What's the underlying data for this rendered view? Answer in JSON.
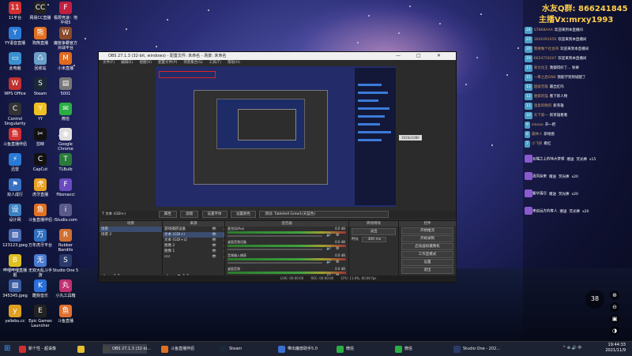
{
  "desktop": {
    "icons": [
      {
        "label": "11平台",
        "color": "#d03030",
        "glyph": "11"
      },
      {
        "label": "网易CC直播",
        "color": "#222",
        "glyph": "CC"
      },
      {
        "label": "极限竞速：地平线5",
        "color": "#c02040",
        "glyph": "F"
      },
      {
        "label": "YY语音直播",
        "color": "#2b7bd6",
        "glyph": "Y"
      },
      {
        "label": "狗熊直播",
        "color": "#e07020",
        "glyph": "熊"
      },
      {
        "label": "魔兽争霸官方对战平台",
        "color": "#8a4a2a",
        "glyph": "W"
      },
      {
        "label": "此电脑",
        "color": "#3a90d0",
        "glyph": "▭"
      },
      {
        "label": "回收站",
        "color": "#6aa0c8",
        "glyph": "♺"
      },
      {
        "label": "小米直播",
        "color": "#e06a20",
        "glyph": "M"
      },
      {
        "label": "WPS Office",
        "color": "#c03030",
        "glyph": "W"
      },
      {
        "label": "Steam",
        "color": "#1b2838",
        "glyph": "S"
      },
      {
        "label": "5001",
        "color": "#777",
        "glyph": "▤"
      },
      {
        "label": "Control Singularity",
        "color": "#333",
        "glyph": "C"
      },
      {
        "label": "YY",
        "color": "#f0c020",
        "glyph": "Y"
      },
      {
        "label": "微信",
        "color": "#2aae44",
        "glyph": "✉"
      },
      {
        "label": "斗鱼直播伴侣",
        "color": "#d03030",
        "glyph": "鱼"
      },
      {
        "label": "剪映",
        "color": "#111",
        "glyph": "✂"
      },
      {
        "label": "Google Chrome",
        "color": "#dfdfdf",
        "glyph": "◉"
      },
      {
        "label": "迅雷",
        "color": "#2a7ad8",
        "glyph": "⚡"
      },
      {
        "label": "CapCut",
        "color": "#111",
        "glyph": "C"
      },
      {
        "label": "TLBulb",
        "color": "#2a7a3a",
        "glyph": "T"
      },
      {
        "label": "双人成行",
        "color": "#3a70c0",
        "glyph": "⚑"
      },
      {
        "label": "虎牙直播",
        "color": "#e8a020",
        "glyph": "虎"
      },
      {
        "label": "Fibonacci",
        "color": "#6a4ac0",
        "glyph": "F"
      },
      {
        "label": "设计网",
        "color": "#3a80c0",
        "glyph": "设"
      },
      {
        "label": "斗鱼直播伴侣",
        "color": "#e07020",
        "glyph": "鱼"
      },
      {
        "label": "iStudio.com",
        "color": "#5a5a8a",
        "glyph": "i"
      },
      {
        "label": "123123.jpeg",
        "color": "#4a6ab0",
        "glyph": "▧"
      },
      {
        "label": "万年虎牙平台",
        "color": "#3070c0",
        "glyph": "万"
      },
      {
        "label": "Rubber Bandits",
        "color": "#d07030",
        "glyph": "R"
      },
      {
        "label": "哔哩哔哩直播姬",
        "color": "#e0c020",
        "glyph": "B"
      },
      {
        "label": "无双大乱斗手游",
        "color": "#4a7ad0",
        "glyph": "无"
      },
      {
        "label": "Studio One 5",
        "color": "#2a3a6a",
        "glyph": "S"
      },
      {
        "label": "345345.jpeg",
        "color": "#3a5aa0",
        "glyph": "▧"
      },
      {
        "label": "酷狗音乐",
        "color": "#2a70d8",
        "glyph": "K"
      },
      {
        "label": "小丸工具箱",
        "color": "#c03070",
        "glyph": "丸"
      },
      {
        "label": "yaliebu.cc",
        "color": "#e0a020",
        "glyph": "y"
      },
      {
        "label": "Epic Games Launcher",
        "color": "#222",
        "glyph": "E"
      },
      {
        "label": "斗鱼直播",
        "color": "#e07030",
        "glyph": "鱼"
      }
    ]
  },
  "live_panel": {
    "qq_group": "水友Q群: 866241845",
    "host": "主播Vx:mrxy1993",
    "chat": [
      {
        "level": "24",
        "name": "GT868AAA",
        "text": "欢迎来到本直播间"
      },
      {
        "level": "23",
        "name": "1641091656",
        "text": "欢迎来到本直播间"
      },
      {
        "level": "20",
        "name": "我要做个社会哥",
        "text": "欢迎来到本直播间"
      },
      {
        "level": "19",
        "name": "6654759207",
        "text": "欢迎来到本直播间"
      },
      {
        "level": "17",
        "name": "宋文化王",
        "text": "我都得好了... 秋裤"
      },
      {
        "level": "15",
        "name": "一拳之后GNK",
        "text": "我能学到到城配了"
      },
      {
        "level": "13",
        "name": "超级无敌",
        "text": "最出红吗"
      },
      {
        "level": "12",
        "name": "谁家的猫",
        "text": "看下新人物"
      },
      {
        "level": "11",
        "name": "温柔的晚风",
        "text": "新英雄"
      },
      {
        "level": "10",
        "name": "天下第一",
        "text": "新英雄看看"
      },
      {
        "level": "9",
        "name": "xiaoao",
        "text": "开一把"
      },
      {
        "level": "8",
        "name": "森林人",
        "text": "新地图"
      },
      {
        "level": "7",
        "name": "小飞侠",
        "text": "看红"
      }
    ],
    "gifts": [
      {
        "name": "云端之上的伟大梦想",
        "action": "赠送",
        "item": "荧光棒",
        "count": "x15"
      },
      {
        "name": "清风徐来",
        "action": "赠送",
        "item": "荧光棒",
        "count": "x20"
      },
      {
        "name": "繁华落尽",
        "action": "赠送",
        "item": "荧光棒",
        "count": "x20"
      },
      {
        "name": "来自远方的客人",
        "action": "赠送",
        "item": "荧光棒",
        "count": "x20"
      }
    ],
    "viewer_badge": "38",
    "side_icons": [
      "⊕",
      "⊖",
      "▣",
      "◑"
    ]
  },
  "obs": {
    "title": "OBS 27.1.3 (32-bit, windows) - 配置文件: 未命名 - 场景: 未命名",
    "window_controls": [
      "—",
      "□",
      "✕"
    ],
    "menu": [
      "文件(F)",
      "编辑(E)",
      "视图(V)",
      "配置文件(P)",
      "场景集合(S)",
      "工具(T)",
      "帮助(H)"
    ],
    "preview_tag": "1920x1080",
    "source_bar": {
      "source_name": "文本 (GDI+)",
      "buttons": [
        "属性",
        "滤镜",
        "设置字体",
        "设置颜色"
      ],
      "text_value": "测试: Tabletell Grew1(天蓝色)"
    },
    "scenes": {
      "header": "场景",
      "items": [
        "场景",
        "场景 2"
      ]
    },
    "sources": {
      "header": "来源",
      "items": [
        "游戏捕获设备",
        "文本 (GDI+)",
        "文本 (GDI+)2",
        "图像 2",
        "图像 1",
        "ccc"
      ]
    },
    "mixer": {
      "header": "混音器",
      "channels": [
        {
          "name": "麦克风/Aux",
          "db": "0.0 dB"
        },
        {
          "name": "桌面音频设备",
          "db": "0.0 dB"
        },
        {
          "name": "音频输入捕获",
          "db": "0.0 dB"
        },
        {
          "name": "桌面音频",
          "db": "0.0 dB"
        }
      ]
    },
    "transitions": {
      "header": "转场特效",
      "type": "淡出",
      "duration_label": "时长",
      "duration": "300 ms"
    },
    "controls": {
      "header": "控件",
      "buttons": [
        "开始推流",
        "开始录制",
        "启动虚拟摄像机",
        "工作室模式",
        "设置",
        "退出"
      ]
    },
    "status": {
      "live": "LIVE: 00:00:00",
      "rec": "REC: 00:00:00",
      "cpu": "CPU: 11.6%, 60.00 fps"
    }
  },
  "taskbar": {
    "items": [
      {
        "label": "新个性 - 超诛像",
        "color": "#d03030"
      },
      {
        "label": "",
        "color": "#e8c030"
      },
      {
        "label": "OBS 27.1.3 (32-bi...",
        "color": "#444"
      },
      {
        "label": "斗鱼直播伴侣",
        "color": "#e07020"
      },
      {
        "label": "Steam",
        "color": "#1b2838"
      },
      {
        "label": "带出魔兽助手5.0",
        "color": "#3a70d0"
      },
      {
        "label": "微信",
        "color": "#2aae44"
      },
      {
        "label": "微信",
        "color": "#2aae44"
      },
      {
        "label": "Studio One - 202...",
        "color": "#2a3a6a"
      }
    ],
    "time": "19:44:33",
    "date": "2021/11/9",
    "tray": "^ ⊕ 🔊 中"
  }
}
